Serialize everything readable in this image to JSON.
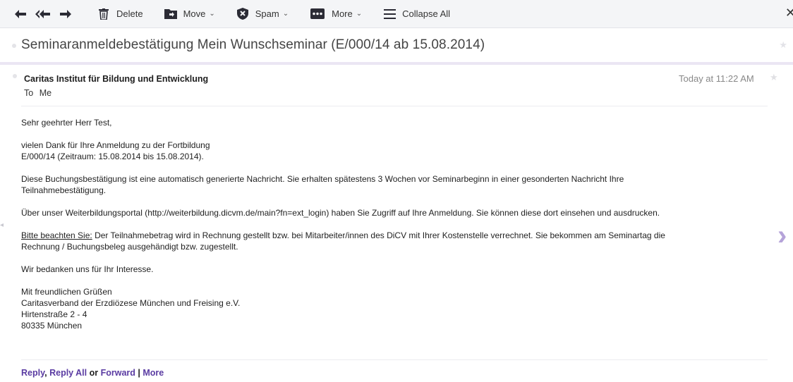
{
  "toolbar": {
    "delete_label": "Delete",
    "move_label": "Move",
    "spam_label": "Spam",
    "more_label": "More",
    "collapse_label": "Collapse All",
    "close_glyph": "✕"
  },
  "subject": "Seminaranmeldebestätigung Mein Wunschseminar (E/000/14 ab 15.08.2014)",
  "message": {
    "sender": "Caritas Institut für Bildung und Entwicklung",
    "to_label": "To",
    "to_value": "Me",
    "time": "Today at 11:22 AM",
    "greeting": "Sehr geehrter Herr Test,",
    "p1_l1": "vielen Dank für Ihre Anmeldung zu der Fortbildung",
    "p1_l2": "E/000/14 (Zeitraum: 15.08.2014 bis 15.08.2014).",
    "p2_l1": "Diese Buchungsbestätigung ist eine automatisch generierte Nachricht. Sie erhalten spätestens 3 Wochen vor Seminarbeginn in einer gesonderten Nachricht Ihre",
    "p2_l2": "Teilnahmebestätigung.",
    "p3": "Über unser Weiterbildungsportal (http://weiterbildung.dicvm.de/main?fn=ext_login) haben Sie Zugriff auf Ihre Anmeldung. Sie können diese dort einsehen und ausdrucken.",
    "p4_underlined": "Bitte beachten Sie:",
    "p4_rest_l1": " Der Teilnahmebetrag wird in Rechnung gestellt bzw. bei Mitarbeiter/innen des DiCV mit Ihrer Kostenstelle verrechnet. Sie bekommen am Seminartag die",
    "p4_l2": "Rechnung / Buchungsbeleg ausgehändigt bzw. zugestellt.",
    "p5": "Wir bedanken uns für Ihr Interesse.",
    "sig_l1": "Mit freundlichen Grüßen",
    "sig_l2": "Caritasverband der Erzdiözese München und Freising e.V.",
    "sig_l3": "Hirtenstraße 2 - 4",
    "sig_l4": "80335 München"
  },
  "reply": {
    "reply_label": "Reply",
    "comma": ",",
    "reply_all_label": "Reply All",
    "or_label": "or",
    "forward_label": "Forward",
    "pipe": "|",
    "more_label": "More"
  },
  "colors": {
    "accent": "#5a3ba2",
    "toolbar_bg": "#f4f5f7",
    "arrow": "#b5a3d9"
  },
  "icons": [
    "reply-icon",
    "reply-all-icon",
    "forward-icon",
    "trash-icon",
    "folder-icon",
    "shield-icon",
    "ellipsis-icon",
    "list-icon",
    "close-icon",
    "star-icon",
    "chevron-right-icon"
  ]
}
